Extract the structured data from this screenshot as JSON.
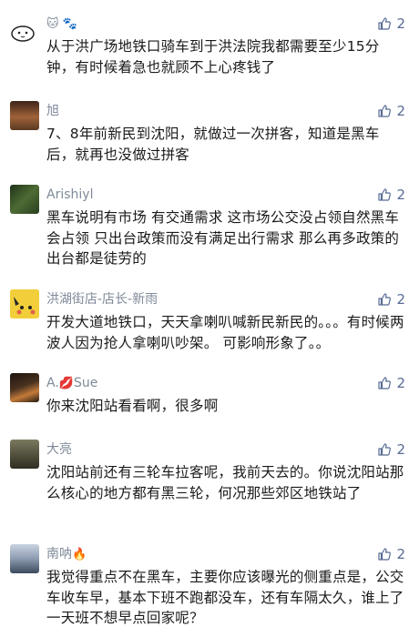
{
  "comments": [
    {
      "nick": "",
      "nick_emoji": "🐱 🐾",
      "likes": "2",
      "text": "从于洪广场地铁口骑车到于洪法院我都需要至少15分钟，有时候着急也就顾不上心疼钱了",
      "avatar_color": "#ffffff"
    },
    {
      "nick": "旭",
      "nick_emoji": "",
      "likes": "2",
      "text": "7、8年前新民到沈阳，就做过一次拼客，知道是黑车后，就再也没做过拼客",
      "avatar_color": "#8a5b3c"
    },
    {
      "nick": "Arishiyl",
      "nick_emoji": "",
      "likes": "2",
      "text": "黑车说明有市场  有交通需求  这市场公交没占领自然黑车会占领  只出台政策而没有满足出行需求  那么再多政策的出台都是徒劳的",
      "avatar_color": "#3f5a2e"
    },
    {
      "nick": "洪湖街店-店长-新雨",
      "nick_emoji": "",
      "likes": "2",
      "text": "开发大道地铁口，天天拿喇叭喊新民新民的。。。有时候两波人因为抢人拿喇叭吵架。 可影响形象了。。",
      "avatar_color": "#e8c23a"
    },
    {
      "nick": "A.",
      "nick_emoji": "💋",
      "nick_suffix": "Sue",
      "likes": "2",
      "text": "你来沈阳站看看啊，很多啊",
      "avatar_color": "#3a2a1a"
    },
    {
      "nick": "大亮",
      "nick_emoji": "",
      "likes": "2",
      "text": "沈阳站前还有三轮车拉客呢，我前天去的。你说沈阳站那么核心的地方都有黑三轮，何况那些郊区地铁站了",
      "avatar_color": "#6b6b55"
    },
    {
      "nick": "南呐",
      "nick_emoji": "🔥",
      "likes": "2",
      "text": "我觉得重点不在黑车，主要你应该曝光的侧重点是，公交车收车早，基本下班不跑都没车，还有车隔太久，谁上了一天班不想早点回家呢？",
      "avatar_color": "#9aa6b8"
    }
  ],
  "colors": {
    "nick": "#7f8a99",
    "like": "#576b95",
    "text": "#1a1a1a"
  }
}
